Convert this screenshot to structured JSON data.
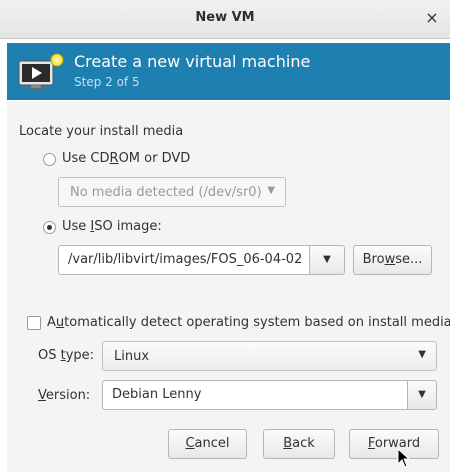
{
  "window": {
    "title": "New VM",
    "close_glyph": "×"
  },
  "header": {
    "title": "Create a new virtual machine",
    "step": "Step 2 of 5",
    "icon": "monitor-new-icon",
    "bg_color": "#1e80b0"
  },
  "media": {
    "section_label": "Locate your install media",
    "cdrom": {
      "label_pre": "Use CD",
      "label_mnemonic": "R",
      "label_post": "OM or DVD",
      "selected": false
    },
    "cdrom_select": {
      "value": "No media detected (/dev/sr0)",
      "disabled": true
    },
    "iso": {
      "label_pre": "Use ",
      "label_mnemonic": "I",
      "label_post": "SO image:",
      "selected": true
    },
    "iso_path": "/var/lib/libvirt/images/FOS_06-04-02",
    "browse": {
      "pre": "Bro",
      "mnemonic": "w",
      "post": "se..."
    }
  },
  "detect": {
    "pre": "A",
    "mnemonic": "u",
    "post": "tomatically detect operating system based on install media",
    "checked": false
  },
  "os_type": {
    "label_pre": "OS ",
    "label_mnemonic": "t",
    "label_post": "ype:",
    "value": "Linux"
  },
  "version": {
    "label_mnemonic": "V",
    "label_post": "ersion:",
    "value": "Debian Lenny"
  },
  "buttons": {
    "cancel": {
      "mnemonic": "C",
      "post": "ancel"
    },
    "back": {
      "mnemonic": "B",
      "post": "ack"
    },
    "forward": {
      "mnemonic": "F",
      "post": "orward"
    }
  }
}
